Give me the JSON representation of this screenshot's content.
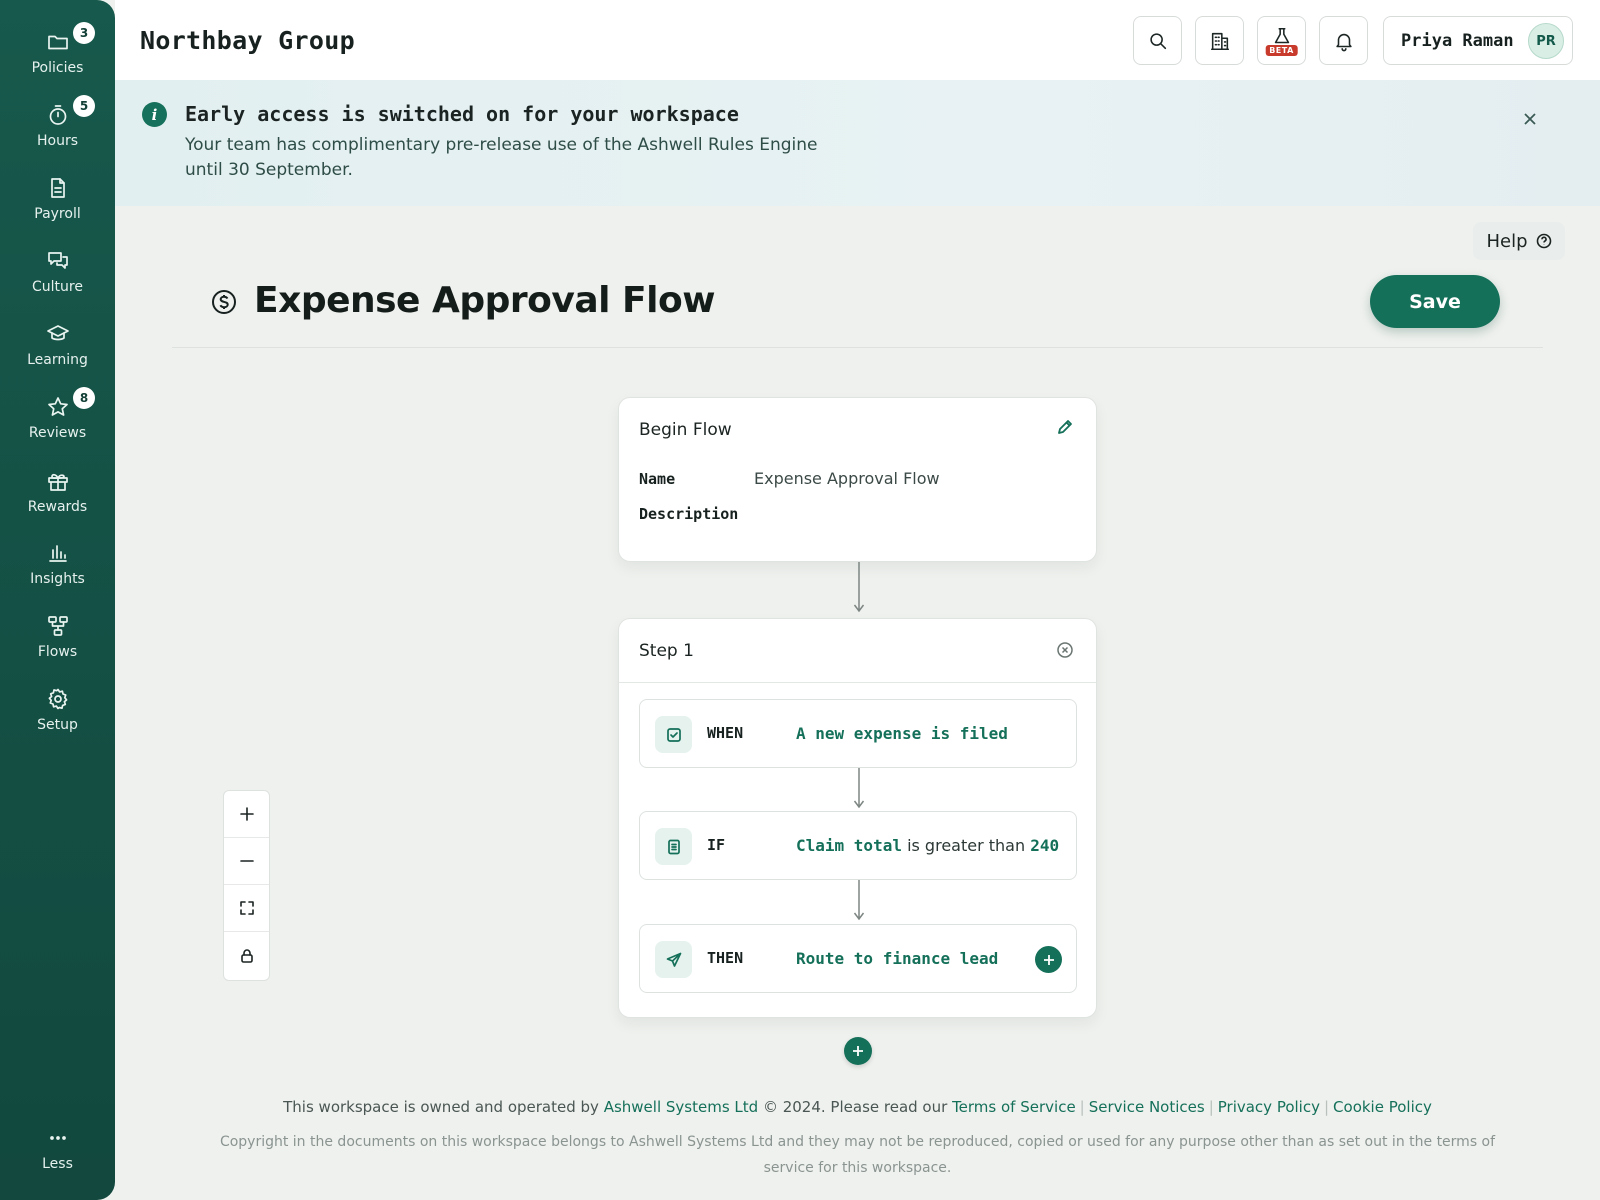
{
  "sidebar": {
    "items": [
      {
        "label": "Policies",
        "icon": "folder-icon",
        "badge": "3"
      },
      {
        "label": "Hours",
        "icon": "timer-icon",
        "badge": "5"
      },
      {
        "label": "Payroll",
        "icon": "document-icon",
        "badge": ""
      },
      {
        "label": "Culture",
        "icon": "chat-bubbles-icon",
        "badge": ""
      },
      {
        "label": "Learning",
        "icon": "graduation-cap-icon",
        "badge": ""
      },
      {
        "label": "Reviews",
        "icon": "star-icon",
        "badge": "8"
      },
      {
        "label": "Rewards",
        "icon": "gift-icon",
        "badge": ""
      },
      {
        "label": "Insights",
        "icon": "bar-chart-icon",
        "badge": ""
      },
      {
        "label": "Flows",
        "icon": "flow-diagram-icon",
        "badge": ""
      },
      {
        "label": "Setup",
        "icon": "gear-icon",
        "badge": ""
      }
    ],
    "less_label": "Less"
  },
  "header": {
    "org_name": "Northbay Group",
    "buttons": [
      "search-icon",
      "building-icon",
      "flask-beta-icon",
      "bell-icon"
    ],
    "beta_label": "BETA",
    "user_name": "Priya Raman",
    "user_initials": "PR"
  },
  "banner": {
    "title": "Early access is switched on for your workspace",
    "text": "Your team has complimentary pre-release use of the Ashwell Rules Engine until 30 September."
  },
  "help_label": "Help",
  "page": {
    "title": "Expense Approval Flow",
    "save_label": "Save"
  },
  "begin_card": {
    "title": "Begin Flow",
    "name_label": "Name",
    "name_value": "Expense Approval Flow",
    "description_label": "Description",
    "description_value": ""
  },
  "step": {
    "title": "Step 1",
    "when": {
      "keyword": "WHEN",
      "text": "A new expense is filed"
    },
    "if": {
      "keyword": "IF",
      "field": "Claim total",
      "operator": "is greater than",
      "value": "240"
    },
    "then": {
      "keyword": "THEN",
      "text": "Route to finance lead"
    }
  },
  "footer": {
    "prefix": "This workspace is owned and operated by",
    "company": "Ashwell Systems Ltd",
    "mid": "© 2024. Please read our",
    "links": [
      "Terms of Service",
      "Service Notices",
      "Privacy Policy",
      "Cookie Policy"
    ],
    "copyright": "Copyright in the documents on this workspace belongs to Ashwell Systems Ltd and they may not be reproduced, copied or used for any purpose other than as set out in the terms of service for this workspace."
  },
  "colors": {
    "sidebar": "#17594c",
    "accent": "#15705a",
    "beta": "#c83a2b",
    "banner": "#e4eff1"
  }
}
